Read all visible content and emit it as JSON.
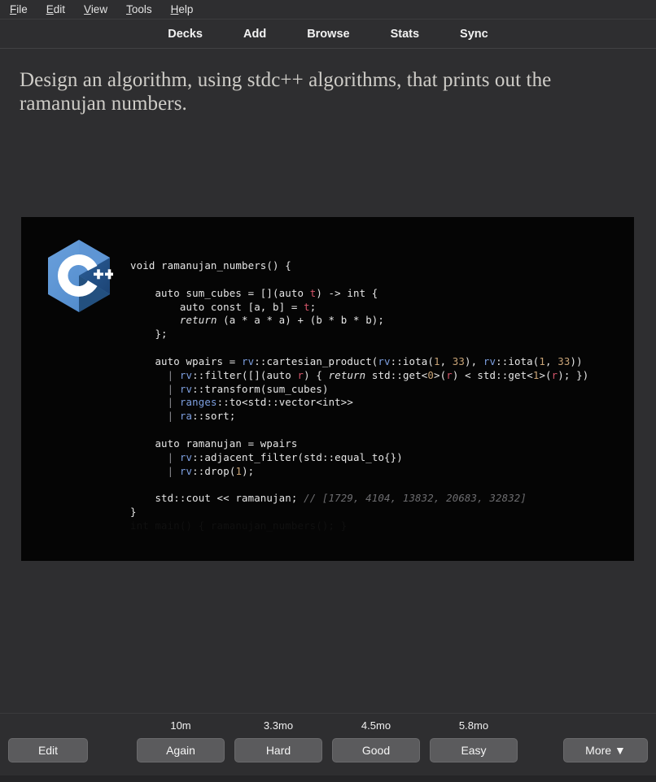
{
  "menubar": {
    "items": [
      {
        "label": "File",
        "accel": "F",
        "rest": "ile"
      },
      {
        "label": "Edit",
        "accel": "E",
        "rest": "dit"
      },
      {
        "label": "View",
        "accel": "V",
        "rest": "iew"
      },
      {
        "label": "Tools",
        "accel": "T",
        "rest": "ools"
      },
      {
        "label": "Help",
        "accel": "H",
        "rest": "elp"
      }
    ]
  },
  "topnav": {
    "items": [
      {
        "label": "Decks"
      },
      {
        "label": "Add"
      },
      {
        "label": "Browse"
      },
      {
        "label": "Stats"
      },
      {
        "label": "Sync"
      }
    ]
  },
  "card": {
    "question": "Design an algorithm, using stdc++ algorithms, that prints out the ramanujan numbers.",
    "code_image": {
      "logo": "cpp-logo",
      "background": "#050505",
      "lines": [
        "void ramanujan_numbers() {",
        "",
        "    auto sum_cubes = [](auto t) -> int {",
        "        auto const [a, b] = t;",
        "        return (a * a * a) + (b * b * b);",
        "    };",
        "",
        "    auto wpairs = rv::cartesian_product(rv::iota(1, 33), rv::iota(1, 33))",
        "         | rv::filter([](auto r) { return std::get<0>(r) < std::get<1>(r); })",
        "         | rv::transform(sum_cubes)",
        "         | ranges::to<std::vector<int>>",
        "         | ra::sort;",
        "",
        "    auto ramanujan = wpairs",
        "         | rv::adjacent_filter(std::equal_to{})",
        "         | rv::drop(1);",
        "",
        "    std::cout << ramanujan; // [1729, 4104, 13832, 20683, 32832]",
        "}"
      ],
      "comment_values": "[1729, 4104, 13832, 20683, 32832]"
    }
  },
  "answerbar": {
    "edit_label": "Edit",
    "more_label": "More ▼",
    "answers": [
      {
        "eta": "10m",
        "label": "Again"
      },
      {
        "eta": "3.3mo",
        "label": "Hard"
      },
      {
        "eta": "4.5mo",
        "label": "Good"
      },
      {
        "eta": "5.8mo",
        "label": "Easy"
      }
    ]
  },
  "colors": {
    "app_bg": "#2e2e30",
    "code_bg": "#050505",
    "question_text": "#cfcdc8",
    "namespace": "#7d9fe0",
    "number": "#c9a477",
    "variable": "#d4556a",
    "comment": "#6d6d70",
    "button_bg": "#5b5b5d"
  }
}
